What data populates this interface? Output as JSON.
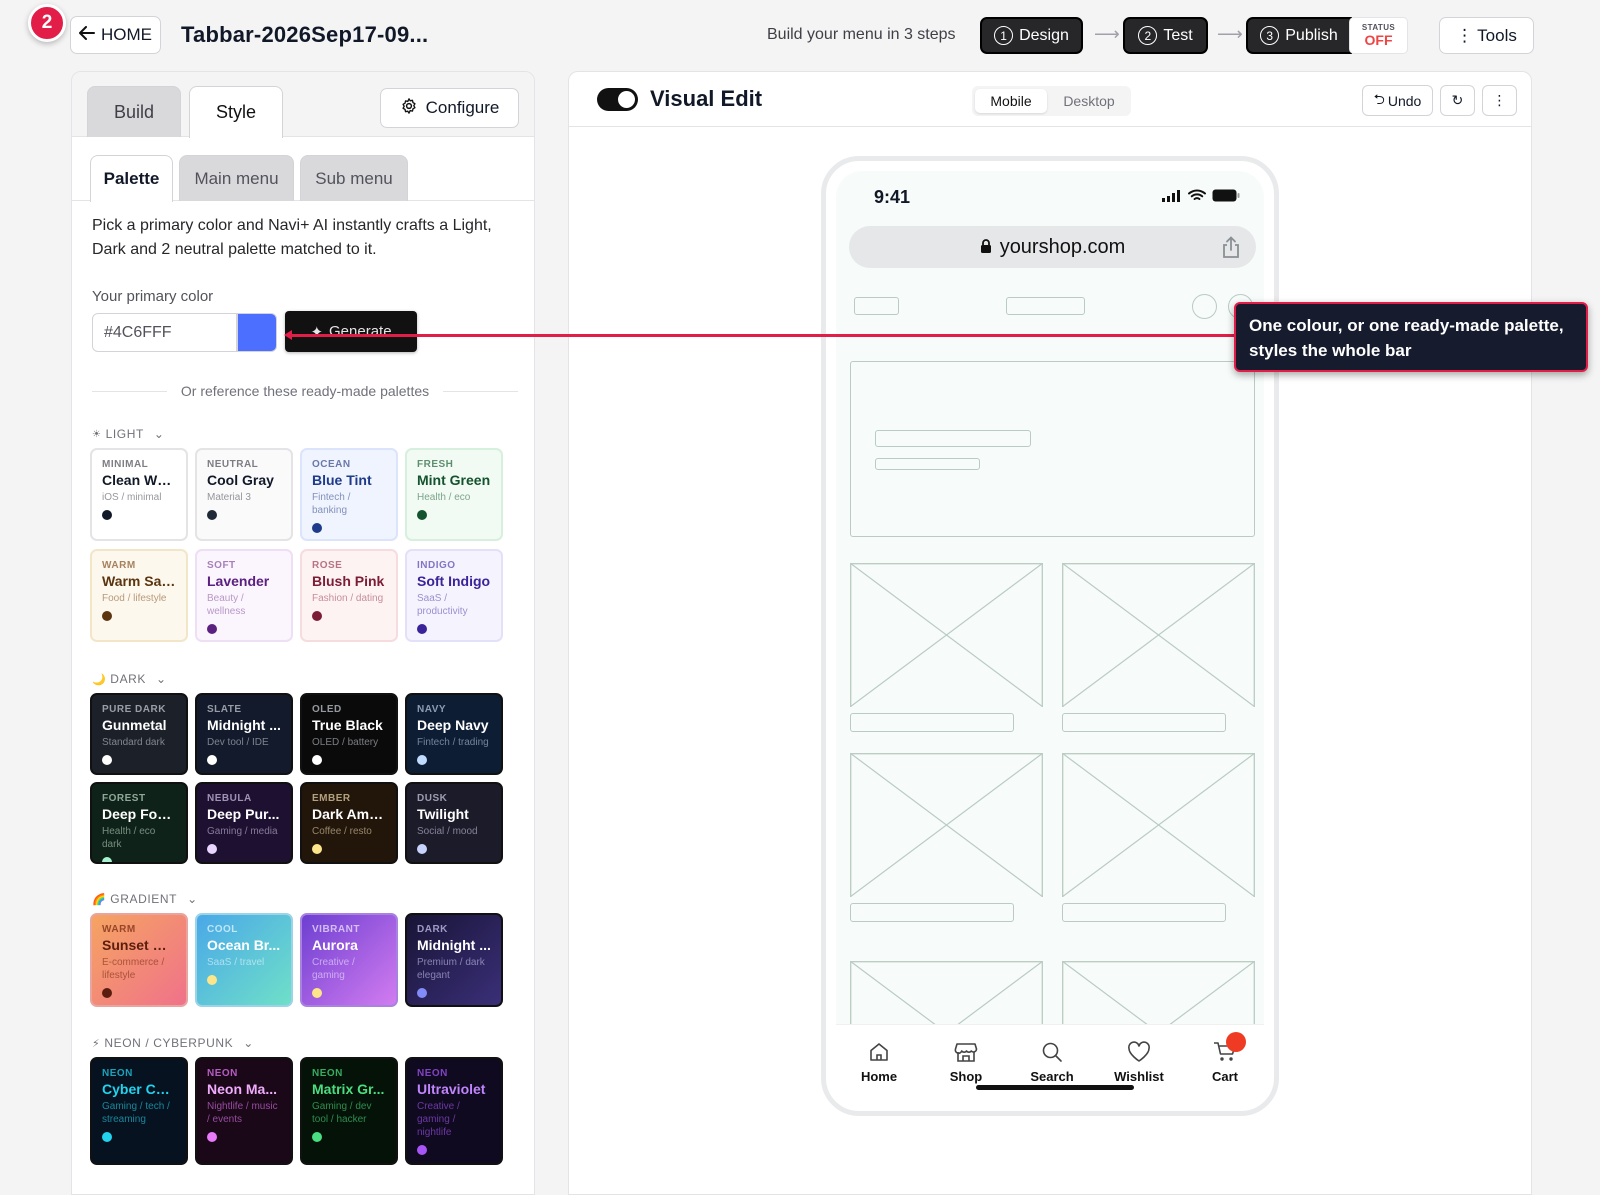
{
  "header": {
    "step_badge": "2",
    "home_label": "HOME",
    "doc_title": "Tabbar-2026Sep17-09...",
    "steps_label": "Build your menu in 3 steps",
    "steps": [
      {
        "num": "1",
        "label": "Design"
      },
      {
        "num": "2",
        "label": "Test"
      },
      {
        "num": "3",
        "label": "Publish"
      }
    ],
    "status_label": "STATUS",
    "status_value": "OFF",
    "tools_label": "Tools"
  },
  "left": {
    "tabs": [
      "Build",
      "Style"
    ],
    "configure_label": "Configure",
    "subtabs": [
      "Palette",
      "Main menu",
      "Sub menu"
    ],
    "intro": "Pick a primary color and Navi+ AI instantly crafts a Light, Dark and 2 neutral palette matched to it.",
    "primary_color_label": "Your primary color",
    "primary_color_value": "#4C6FFF",
    "generate_label": "Generate",
    "divider_text": "Or reference these ready-made palettes",
    "groups": [
      {
        "label": "LIGHT",
        "icon": "☀"
      },
      {
        "label": "DARK",
        "icon": "🌙"
      },
      {
        "label": "GRADIENT",
        "icon": "🌈"
      },
      {
        "label": "NEON / CYBERPUNK",
        "icon": "⚡"
      }
    ],
    "palettes": {
      "light": [
        {
          "tag": "MINIMAL",
          "name": "Clean Wh...",
          "desc": "iOS / minimal",
          "bg": "#ffffff",
          "fg": "#111827",
          "tagc": "#52525b",
          "dot": "#111827",
          "border": "#e4e4e7"
        },
        {
          "tag": "NEUTRAL",
          "name": "Cool Gray",
          "desc": "Material 3",
          "bg": "#fafafb",
          "fg": "#111827",
          "tagc": "#52525b",
          "dot": "#1f2937",
          "border": "#e4e4e7"
        },
        {
          "tag": "OCEAN",
          "name": "Blue Tint",
          "desc": "Fintech / banking",
          "bg": "#eff4ff",
          "fg": "#1e3a8a",
          "tagc": "#3b4f8a",
          "dot": "#1e3a8a",
          "border": "#dbe4fb"
        },
        {
          "tag": "FRESH",
          "name": "Mint Green",
          "desc": "Health / eco",
          "bg": "#f1faf3",
          "fg": "#14532d",
          "tagc": "#2f6b44",
          "dot": "#14532d",
          "border": "#d7efdd"
        },
        {
          "tag": "WARM",
          "name": "Warm Sand",
          "desc": "Food / lifestyle",
          "bg": "#fdf8ee",
          "fg": "#5b3410",
          "tagc": "#8a5a2c",
          "dot": "#5b3410",
          "border": "#f3e6c8"
        },
        {
          "tag": "SOFT",
          "name": "Lavender",
          "desc": "Beauty / wellness",
          "bg": "#fbf5fd",
          "fg": "#5b2180",
          "tagc": "#8a5aa3",
          "dot": "#5b2180",
          "border": "#efdff5"
        },
        {
          "tag": "ROSE",
          "name": "Blush Pink",
          "desc": "Fashion / dating",
          "bg": "#fdf3f3",
          "fg": "#7c1d36",
          "tagc": "#a3485e",
          "dot": "#7c1d36",
          "border": "#f6dcdf"
        },
        {
          "tag": "INDIGO",
          "name": "Soft Indigo",
          "desc": "SaaS / productivity",
          "bg": "#f5f4fe",
          "fg": "#3b2399",
          "tagc": "#5d4bb0",
          "dot": "#3b2399",
          "border": "#e3e0fa"
        }
      ],
      "dark": [
        {
          "tag": "PURE DARK",
          "name": "Gunmetal",
          "desc": "Standard dark",
          "bg": "#1b2029",
          "fg": "#ffffff",
          "tagc": "#c4c8d0",
          "dot": "#ffffff",
          "border": "#111"
        },
        {
          "tag": "SLATE",
          "name": "Midnight ...",
          "desc": "Dev tool / IDE",
          "bg": "#121a2b",
          "fg": "#ffffff",
          "tagc": "#c4c8d0",
          "dot": "#ffffff",
          "border": "#111"
        },
        {
          "tag": "OLED",
          "name": "True Black",
          "desc": "OLED / battery",
          "bg": "#0a0a0a",
          "fg": "#ffffff",
          "tagc": "#c4c8d0",
          "dot": "#ffffff",
          "border": "#111"
        },
        {
          "tag": "NAVY",
          "name": "Deep Navy",
          "desc": "Fintech / trading",
          "bg": "#0d1d33",
          "fg": "#ffffff",
          "tagc": "#b8c6dd",
          "dot": "#bfdbfe",
          "border": "#111"
        },
        {
          "tag": "FOREST",
          "name": "Deep Forest",
          "desc": "Health / eco dark",
          "bg": "#0f2219",
          "fg": "#ffffff",
          "tagc": "#b9d4c3",
          "dot": "#a7f3d0",
          "border": "#111"
        },
        {
          "tag": "NEBULA",
          "name": "Deep Pur...",
          "desc": "Gaming / media",
          "bg": "#1d1030",
          "fg": "#ffffff",
          "tagc": "#cbbde0",
          "dot": "#e9d5ff",
          "border": "#111"
        },
        {
          "tag": "EMBER",
          "name": "Dark Amber",
          "desc": "Coffee / resto",
          "bg": "#22160b",
          "fg": "#ffffff",
          "tagc": "#e4cfa5",
          "dot": "#fde68a",
          "border": "#111"
        },
        {
          "tag": "DUSK",
          "name": "Twilight",
          "desc": "Social / mood",
          "bg": "#1c1b2a",
          "fg": "#ffffff",
          "tagc": "#c8c6dc",
          "dot": "#c7d2fe",
          "border": "#111"
        }
      ],
      "gradient": [
        {
          "tag": "WARM",
          "name": "Sunset Gl...",
          "desc": "E-commerce / lifestyle",
          "bg": "linear-gradient(135deg,#f5a462,#f0728a)",
          "fg": "#5b1e0e",
          "tagc": "#7a2a14",
          "dot": "#5b1e0e",
          "border": "#e9a4a0"
        },
        {
          "tag": "COOL",
          "name": "Ocean Br...",
          "desc": "SaaS / travel",
          "bg": "linear-gradient(135deg,#4aa8e8,#6fe0c8)",
          "fg": "#ffffff",
          "tagc": "#e6f6ff",
          "dot": "#fde68a",
          "border": "#9bd3e8"
        },
        {
          "tag": "VIBRANT",
          "name": "Aurora",
          "desc": "Creative / gaming",
          "bg": "linear-gradient(135deg,#6d3fd1,#d27cf0)",
          "fg": "#ffffff",
          "tagc": "#efe3ff",
          "dot": "#fde68a",
          "border": "#a981e0"
        },
        {
          "tag": "DARK",
          "name": "Midnight ...",
          "desc": "Premium / dark elegant",
          "bg": "linear-gradient(135deg,#181436,#3a2f78)",
          "fg": "#ffffff",
          "tagc": "#c9c3f0",
          "dot": "#818cf8",
          "border": "#111"
        }
      ],
      "neon": [
        {
          "tag": "NEON",
          "name": "Cyber Cyan",
          "desc": "Gaming / tech / streaming",
          "bg": "#06121f",
          "fg": "#22d3ee",
          "tagc": "#22d3ee",
          "dot": "#22d3ee",
          "border": "#111"
        },
        {
          "tag": "NEON",
          "name": "Neon Ma...",
          "desc": "Nightlife / music / events",
          "bg": "#1a0818",
          "fg": "#f0abfc",
          "tagc": "#e879f9",
          "dot": "#e879f9",
          "border": "#111"
        },
        {
          "tag": "NEON",
          "name": "Matrix Gr...",
          "desc": "Gaming / dev tool / hacker",
          "bg": "#041207",
          "fg": "#4ade80",
          "tagc": "#4ade80",
          "dot": "#4ade80",
          "border": "#111"
        },
        {
          "tag": "NEON",
          "name": "Ultraviolet",
          "desc": "Creative / gaming / nightlife",
          "bg": "#0f0a20",
          "fg": "#c084fc",
          "tagc": "#a855f7",
          "dot": "#a855f7",
          "border": "#111"
        }
      ]
    }
  },
  "right": {
    "title": "Visual Edit",
    "view_modes": [
      "Mobile",
      "Desktop"
    ],
    "undo_label": "Undo",
    "phone": {
      "time": "9:41",
      "url": "yourshop.com",
      "nav_items": [
        "Home",
        "Shop",
        "Search",
        "Wishlist",
        "Cart"
      ]
    }
  },
  "callout": {
    "text": "One colour, or one ready-made palette, styles the whole bar"
  },
  "colors": {
    "accent": "#e11d48",
    "primary": "#4c6fff",
    "cart_badge": "#ef3b24"
  }
}
